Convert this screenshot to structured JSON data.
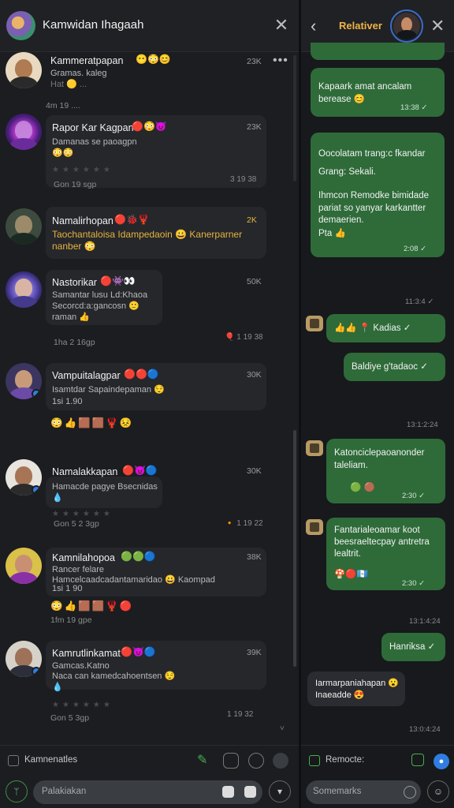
{
  "left": {
    "title": "Kamwidan Ihagaah",
    "more": "•••",
    "comments": [
      {
        "name": "Kammeratpapan",
        "emoji": "😶😳😊",
        "text1": "Gramas. kaleg",
        "text2": "Hat 🟡 ...",
        "count": "23K",
        "meta": "4m 19 ...."
      },
      {
        "name": "Rapor Kar Kagpan",
        "emoji": "🔴😳😈",
        "text1": "Damanas se paoagpn",
        "text2": "😳😳",
        "time": "3 19 38",
        "count": "23K",
        "meta": "Gon 19 sgp"
      },
      {
        "name": "Namalirhopan",
        "emoji": "🔴🐞🦞",
        "text1": "Taochantaloisa Idampedaoin 😀 Kanerparner",
        "text2": "nanber 😳",
        "count": "2K",
        "gold": true
      },
      {
        "name": "Nastorikar",
        "emoji": "🔴👾👀",
        "text1": "Samantar lusu Ld:Khaoa",
        "text2": "Secorcd:a:gancosn 🙂",
        "text3": "raman 👍",
        "time": "🎈 1 19 38",
        "count": "50K",
        "meta": "1ha 2 16gp"
      },
      {
        "name": "Vampuitalagpar",
        "emoji": "🔴🔴🔵",
        "text1": "Isamtdar Sapaindepaman 😌",
        "text2": "1si 1.90",
        "count": "30K",
        "react": "😳👍🟫🟫🦞😣"
      },
      {
        "name": "Namalakkapan",
        "emoji": "🔴😈🔵",
        "text1": "Hamacde pagye Bsecnidas",
        "text2": "💧",
        "time": "🔸 1 19 22",
        "count": "30K",
        "meta": "Gon 5 2 3gp"
      },
      {
        "name": "Kamnilahopoa",
        "emoji": "🟢🟢🔵",
        "text1": "Rancer felare",
        "text2": "Hamcelcaadcadantamaridao 😀 Kaompad",
        "text3": "1si 1 90",
        "count": "38K",
        "react": "😳👍🟫🟫🦞🔴",
        "meta": "1fm 19 gpe"
      },
      {
        "name": "Kamrutlinkamat",
        "emoji": "🔴😈🔵",
        "text1": "Gamcas.Katno",
        "text2": "Naca can kamedcahoentsen 😌",
        "text3": "💧",
        "time": "1 19 32",
        "count": "39K",
        "meta": "Gon 5 3gp"
      }
    ],
    "footer_label": "Kamnenatles",
    "composer_placeholder": "Palakiakan"
  },
  "right": {
    "title": "Relativer",
    "messages": [
      {
        "text1": "Kapaark amat ancalam",
        "text2": "berease 😊",
        "time": "13:38 ✓",
        "dir": "out"
      },
      {
        "text1": "Oocolatam trang:c fkandar",
        "text2": "Grang: Sekali.",
        "text3": "Ihmcon Remodke bimidade",
        "text4": "pariat so yanyar karkantter",
        "text5": "demaerien.",
        "text6": "Pta 👍",
        "time": "2:08 ✓",
        "dir": "out"
      },
      {
        "text1": "👍👍 📍 Kadias ✓",
        "dir": "out"
      },
      {
        "text1": "Baldiye g'tadaoc ✓",
        "dir": "out"
      },
      {
        "text1": "Katonciclepaoanonder",
        "text2": "taleliam.",
        "text3": "🟢 🟤",
        "time": "2:30 ✓",
        "dir": "out"
      },
      {
        "text1": "Fantarialeoamar koot",
        "text2": "beesraeltecpay antretra",
        "text3": "lealtrit.",
        "text4": "🍄🔴🇬🇹",
        "time": "2:30 ✓",
        "dir": "out"
      },
      {
        "text1": "Hanriksa ✓",
        "dir": "out"
      },
      {
        "text1": "Iarmarpaniahapan 😮",
        "text2": "Inaeadde 😍",
        "dir": "in"
      }
    ],
    "day_labels": [
      "11:3:4 ✓",
      "13:1:2:24",
      "13:1:4:24",
      "13:0:4:24"
    ],
    "footer_label": "Remocte:",
    "composer_placeholder": "Somemarks"
  }
}
